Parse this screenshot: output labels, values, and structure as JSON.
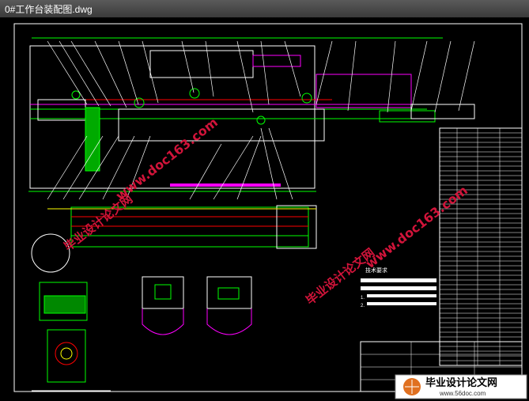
{
  "window": {
    "title": "0#工作台装配图.dwg"
  },
  "drawing": {
    "tech_requirements_title": "技术要求",
    "tech_notes": [
      "1.",
      "2."
    ]
  },
  "watermarks": [
    {
      "text": "www.doc163.com"
    },
    {
      "text": "毕业设计论文网"
    },
    {
      "text": "www.doc163.com"
    },
    {
      "text": "毕业设计论文网"
    }
  ],
  "badge": {
    "title": "毕业设计论文网",
    "url": "www.56doc.com"
  },
  "colors": {
    "background": "#000000",
    "green": "#00ff00",
    "magenta": "#ff00ff",
    "white": "#ffffff",
    "cyan": "#00ffff",
    "watermark": "#d2143a"
  }
}
